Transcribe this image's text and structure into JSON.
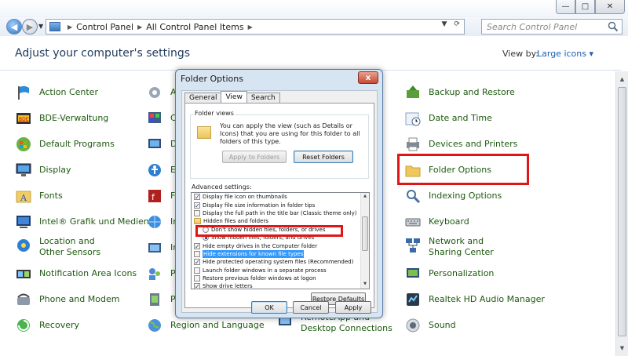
{
  "titlebar": {
    "controls": {
      "minimize": "—",
      "maximize": "□",
      "close": "✕"
    }
  },
  "address": {
    "crumbs": [
      "Control Panel",
      "All Control Panel Items"
    ],
    "search_placeholder": "Search Control Panel"
  },
  "header": {
    "title": "Adjust your computer's settings",
    "view_by_label": "View by:",
    "view_by_value": "Large icons"
  },
  "items": {
    "col1": [
      "Action Center",
      "BDE-Verwaltung",
      "Default Programs",
      "Display",
      "Fonts",
      "Intel® Grafik und Medien",
      "Location and Other Sensors",
      "Notification Area Icons",
      "Phone and Modem",
      "Recovery"
    ],
    "col2": [
      "Ac",
      "Co",
      "De",
      "Ea",
      "Fl",
      "In",
      "In",
      "Pa",
      "Po",
      "Region and Language"
    ],
    "col2b": [
      "RemoteApp and Desktop Connections"
    ],
    "col3": [
      "Backup and Restore",
      "Date and Time",
      "Devices and Printers",
      "Folder Options",
      "Indexing Options",
      "Keyboard",
      "Network and Sharing Center",
      "Personalization",
      "Realtek HD Audio Manager",
      "Sound"
    ]
  },
  "dialog": {
    "title": "Folder Options",
    "close": "x",
    "tabs": [
      "General",
      "View",
      "Search"
    ],
    "active_tab": "View",
    "folder_views": {
      "label": "Folder views",
      "text": "You can apply the view (such as Details or Icons) that you are using for this folder to all folders of this type.",
      "apply_button": "Apply to Folders",
      "reset_button": "Reset Folders"
    },
    "advanced_label": "Advanced settings:",
    "advanced_rows": [
      {
        "kind": "check",
        "on": true,
        "indent": 1,
        "text": "Display file icon on thumbnails"
      },
      {
        "kind": "check",
        "on": true,
        "indent": 1,
        "text": "Display file size information in folder tips"
      },
      {
        "kind": "check",
        "on": false,
        "indent": 1,
        "text": "Display the full path in the title bar (Classic theme only)"
      },
      {
        "kind": "folder",
        "on": false,
        "indent": 1,
        "text": "Hidden files and folders"
      },
      {
        "kind": "radio",
        "on": false,
        "indent": 2,
        "text": "Don't show hidden files, folders, or drives"
      },
      {
        "kind": "radio",
        "on": true,
        "indent": 2,
        "text": "Show hidden files, folders, and drives"
      },
      {
        "kind": "check",
        "on": true,
        "indent": 1,
        "text": "Hide empty drives in the Computer folder"
      },
      {
        "kind": "check",
        "on": false,
        "indent": 1,
        "text": "Hide extensions for known file types",
        "selected": true
      },
      {
        "kind": "check",
        "on": true,
        "indent": 1,
        "text": "Hide protected operating system files (Recommended)"
      },
      {
        "kind": "check",
        "on": false,
        "indent": 1,
        "text": "Launch folder windows in a separate process"
      },
      {
        "kind": "check",
        "on": false,
        "indent": 1,
        "text": "Restore previous folder windows at logon"
      },
      {
        "kind": "check",
        "on": true,
        "indent": 1,
        "text": "Show drive letters"
      }
    ],
    "restore_defaults": "Restore Defaults",
    "ok": "OK",
    "cancel": "Cancel",
    "apply": "Apply"
  },
  "colors": {
    "link_green": "#1e5a10",
    "title_blue": "#1e395b",
    "highlight_red": "#e01616",
    "selection_blue": "#3399ff"
  }
}
